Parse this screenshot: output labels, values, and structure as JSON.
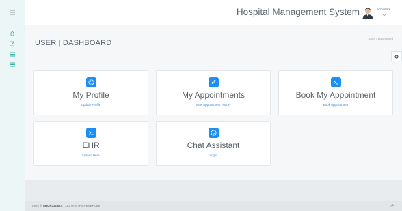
{
  "app": {
    "system_title": "Hospital Management System",
    "user_name": "Abhishek"
  },
  "header": {
    "page_title": "USER | DASHBOARD",
    "breadcrumb": {
      "root": "User",
      "separator": "/",
      "current": "Dashboard"
    }
  },
  "cards": [
    {
      "title": "My Profile",
      "link": "Update Profile",
      "icon": "smiley-icon"
    },
    {
      "title": "My Appointments",
      "link": "View Appointment History",
      "icon": "paperclip-icon"
    },
    {
      "title": "Book My Appointment",
      "link": "Book Appointment",
      "icon": "terminal-icon"
    },
    {
      "title": "EHR",
      "link": "Upload Here",
      "icon": "terminal-icon"
    },
    {
      "title": "Chat Assistant",
      "link": "Login",
      "icon": "smiley-icon"
    }
  ],
  "sidebar": {
    "items": [
      {
        "icon": "home-icon"
      },
      {
        "icon": "edit-icon"
      },
      {
        "icon": "list-icon"
      },
      {
        "icon": "list-icon"
      }
    ]
  },
  "footer": {
    "year": "2022 ©",
    "brand": "SHURAKSHA",
    "rights": "| ALL RIGHTS RESERVED"
  },
  "colors": {
    "accent": "#1a8ff6",
    "link": "#3d8bd8",
    "sidebar_bg": "#edf6f6",
    "sidebar_icon": "#39b2a8"
  }
}
